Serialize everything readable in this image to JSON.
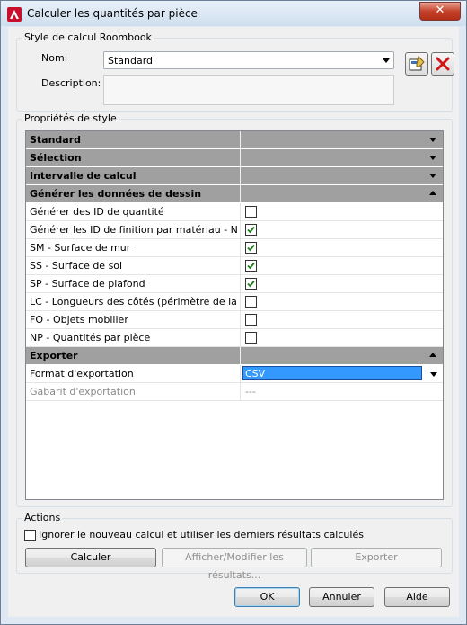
{
  "window": {
    "title": "Calculer les quantités par pièce",
    "close_symbol": "✕"
  },
  "style_group": {
    "legend": "Style de calcul Roombook",
    "name_label": "Nom:",
    "name_value": "Standard",
    "description_label": "Description:",
    "description_value": ""
  },
  "properties": {
    "legend": "Propriétés de style",
    "rows": [
      {
        "label": "Standard",
        "type": "category",
        "expanded": false
      },
      {
        "label": "Sélection",
        "type": "category",
        "expanded": false
      },
      {
        "label": "Intervalle de calcul",
        "type": "category",
        "expanded": false
      },
      {
        "label": "Générer les données de dessin",
        "type": "category",
        "expanded": true
      },
      {
        "label": "Générer des ID de quantité",
        "type": "checkbox",
        "checked": false
      },
      {
        "label": "Générer les ID de finition par matériau - Nor",
        "type": "checkbox",
        "checked": true
      },
      {
        "label": "SM - Surface de mur",
        "type": "checkbox",
        "checked": true
      },
      {
        "label": "SS - Surface de sol",
        "type": "checkbox",
        "checked": true
      },
      {
        "label": "SP - Surface de plafond",
        "type": "checkbox",
        "checked": true
      },
      {
        "label": "LC - Longueurs des côtés (périmètre de la pi",
        "type": "checkbox",
        "checked": false
      },
      {
        "label": "FO - Objets mobilier",
        "type": "checkbox",
        "checked": false
      },
      {
        "label": "NP - Quantités par pièce",
        "type": "checkbox",
        "checked": false
      },
      {
        "label": "Exporter",
        "type": "category",
        "expanded": true
      },
      {
        "label": "Format d'exportation",
        "type": "select",
        "value": "CSV"
      },
      {
        "label": "Gabarit d'exportation",
        "type": "text",
        "value": "---",
        "disabled": true
      }
    ]
  },
  "actions": {
    "legend": "Actions",
    "ignore_label": "Ignorer le nouveau calcul et utiliser les derniers résultats calculés",
    "ignore_checked": false,
    "calc_label": "Calculer",
    "view_label": "Afficher/Modifier les résultats...",
    "export_label": "Exporter"
  },
  "footer": {
    "ok_label": "OK",
    "cancel_label": "Annuler",
    "help_label": "Aide"
  },
  "colors": {
    "category_bg": "#a0a0a0",
    "selection": "#3399ff",
    "check": "#1a7a1a"
  }
}
